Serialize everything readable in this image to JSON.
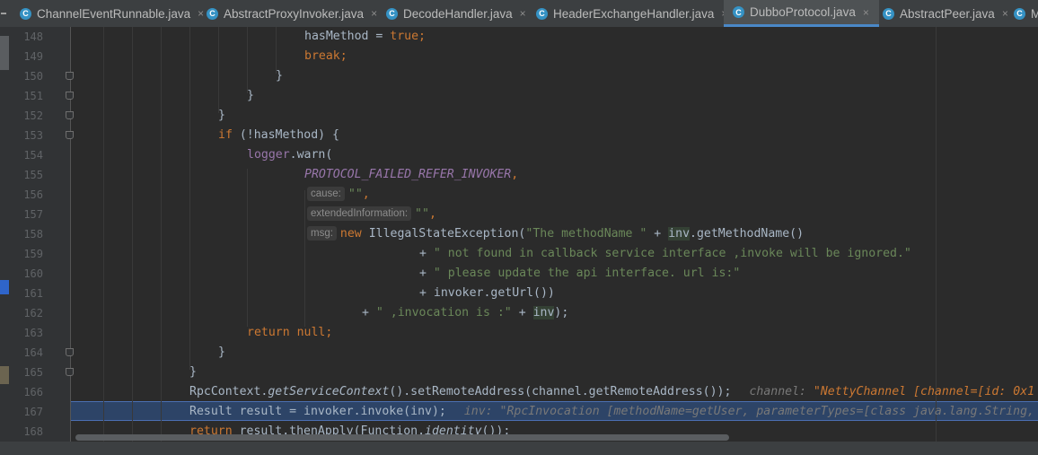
{
  "tabs": [
    {
      "label": "ChannelEventRunnable.java",
      "icon": "C",
      "active": false
    },
    {
      "label": "AbstractProxyInvoker.java",
      "icon": "C",
      "active": false
    },
    {
      "label": "DecodeHandler.java",
      "icon": "C",
      "active": false
    },
    {
      "label": "HeaderExchangeHandler.java",
      "icon": "C",
      "active": false
    },
    {
      "label": "DubboProtocol.java",
      "icon": "C",
      "active": true
    },
    {
      "label": "AbstractPeer.java",
      "icon": "C",
      "active": false
    },
    {
      "label": "M",
      "icon": "C",
      "active": false
    }
  ],
  "tab_close_glyph": "×",
  "editor": {
    "line_numbers": [
      "148",
      "149",
      "150",
      "151",
      "152",
      "153",
      "154",
      "155",
      "156",
      "157",
      "158",
      "159",
      "160",
      "161",
      "162",
      "163",
      "164",
      "165",
      "166",
      "167",
      "168"
    ],
    "current_execution_line": "167"
  },
  "code": {
    "l148": {
      "a": "hasMethod = ",
      "b": "true",
      "c": ";"
    },
    "l149": {
      "a": "break",
      "b": ";"
    },
    "l150": {
      "a": "}"
    },
    "l151": {
      "a": "}"
    },
    "l152": {
      "a": "}"
    },
    "l153": {
      "a": "if",
      "b": " (!hasMethod) {"
    },
    "l154": {
      "a": "logger",
      "b": ".warn("
    },
    "l155": {
      "a": "PROTOCOL_FAILED_REFER_INVOKER",
      "b": ","
    },
    "l156": {
      "hint": "cause:",
      "a": "\"\"",
      "b": ","
    },
    "l157": {
      "hint": "extendedInformation:",
      "a": "\"\"",
      "b": ","
    },
    "l158": {
      "hint": "msg:",
      "a": "new",
      "b": " IllegalStateException(",
      "c": "\"The methodName \"",
      "d": " + ",
      "e": "inv",
      "f": ".getMethodName()"
    },
    "l159": {
      "a": "+ ",
      "b": "\" not found in callback service interface ,invoke will be ignored.\""
    },
    "l160": {
      "a": "+ ",
      "b": "\" please update the api interface. url is:\""
    },
    "l161": {
      "a": "+ invoker.getUrl())"
    },
    "l162": {
      "a": "+ ",
      "b": "\" ,invocation is :\"",
      "c": " + ",
      "d": "inv",
      "e": ");"
    },
    "l163": {
      "a": "return",
      "b": " ",
      "c": "null",
      "d": ";"
    },
    "l164": {
      "a": "}"
    },
    "l165": {
      "a": "}"
    },
    "l166": {
      "a": "RpcContext.",
      "b": "getServiceContext",
      "c": "().setRemoteAddress(channel.getRemoteAddress());",
      "d": "channel: ",
      "e": "\"NettyChannel [channel=[id: 0x1"
    },
    "l167": {
      "a": "Result result = invoker.invoke(inv);",
      "b": "inv: \"RpcInvocation [methodName=getUser, parameterTypes=[class java.lang.String,"
    },
    "l168": {
      "a": "return",
      "b": " result.thenApply(Function.",
      "c": "identity",
      "d": "());"
    }
  },
  "colors": {
    "background": "#2b2b2b",
    "keyword": "#cc7832",
    "string": "#6a8759",
    "field": "#9876aa",
    "execution_line": "#2d4467"
  }
}
